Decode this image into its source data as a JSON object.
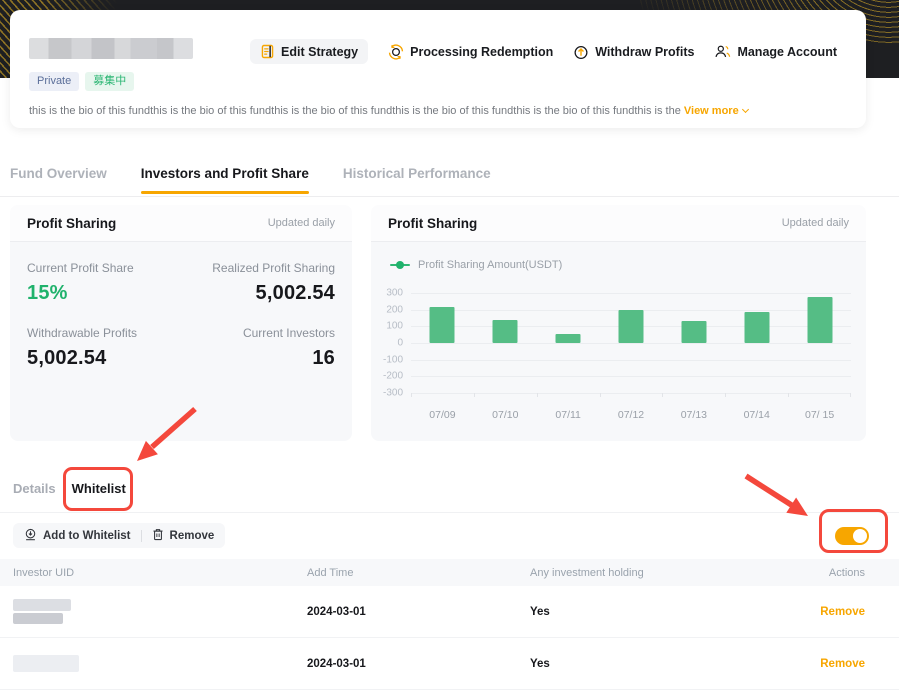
{
  "hero": {
    "badges": [
      {
        "label": "Private"
      },
      {
        "label": "募集中"
      }
    ],
    "bio": "this is the bio of this fundthis is the bio of this fundthis is the bio of this fundthis is the bio of this fundthis is the bio of this fundthis is the ",
    "view_more": "View more",
    "actions": [
      {
        "label": "Edit Strategy",
        "icon": "edit-strategy-icon"
      },
      {
        "label": "Processing Redemption",
        "icon": "processing-redemption-icon"
      },
      {
        "label": "Withdraw Profits",
        "icon": "withdraw-profits-icon"
      },
      {
        "label": "Manage Account",
        "icon": "manage-account-icon"
      }
    ]
  },
  "tabs": [
    {
      "label": "Fund Overview",
      "active": false
    },
    {
      "label": "Investors and Profit Share",
      "active": true
    },
    {
      "label": "Historical Performance",
      "active": false
    }
  ],
  "profit_card": {
    "title": "Profit Sharing",
    "updated": "Updated daily",
    "stats": [
      {
        "label": "Current Profit Share",
        "value": "15%"
      },
      {
        "label": "Realized Profit Sharing",
        "value": "5,002.54"
      },
      {
        "label": "Withdrawable Profits",
        "value": "5,002.54"
      },
      {
        "label": "Current Investors",
        "value": "16"
      }
    ]
  },
  "chart_card": {
    "title": "Profit Sharing",
    "updated": "Updated daily",
    "legend": "Profit Sharing Amount(USDT)"
  },
  "chart_data": {
    "type": "bar",
    "title": "Profit Sharing",
    "legend": [
      "Profit Sharing Amount(USDT)"
    ],
    "legend_position": "top-left",
    "categories": [
      "07/09",
      "07/10",
      "07/11",
      "07/12",
      "07/13",
      "07/14",
      "07/ 15"
    ],
    "values": [
      215,
      140,
      55,
      200,
      130,
      185,
      275
    ],
    "ylim": [
      -300,
      300
    ],
    "yticks": [
      300,
      200,
      100,
      0,
      -100,
      -200,
      -300
    ],
    "grid": true,
    "bar_color": "#55bd85"
  },
  "section_tabs": [
    {
      "label": "Details",
      "active": false
    },
    {
      "label": "Whitelist",
      "active": true
    }
  ],
  "toolbar": {
    "add_label": "Add to Whitelist",
    "remove_label": "Remove"
  },
  "whitelist_toggle": {
    "state": "on"
  },
  "table": {
    "columns": [
      "Investor UID",
      "Add Time",
      "Any investment holding",
      "Actions"
    ],
    "rows": [
      {
        "add_time": "2024-03-01",
        "holding": "Yes",
        "action": "Remove"
      },
      {
        "add_time": "2024-03-01",
        "holding": "Yes",
        "action": "Remove"
      }
    ]
  },
  "colors": {
    "accent_orange": "#f7a600",
    "profit_green": "#20b26c",
    "bar_green": "#55bd85",
    "annotation_red": "#f4483c"
  }
}
